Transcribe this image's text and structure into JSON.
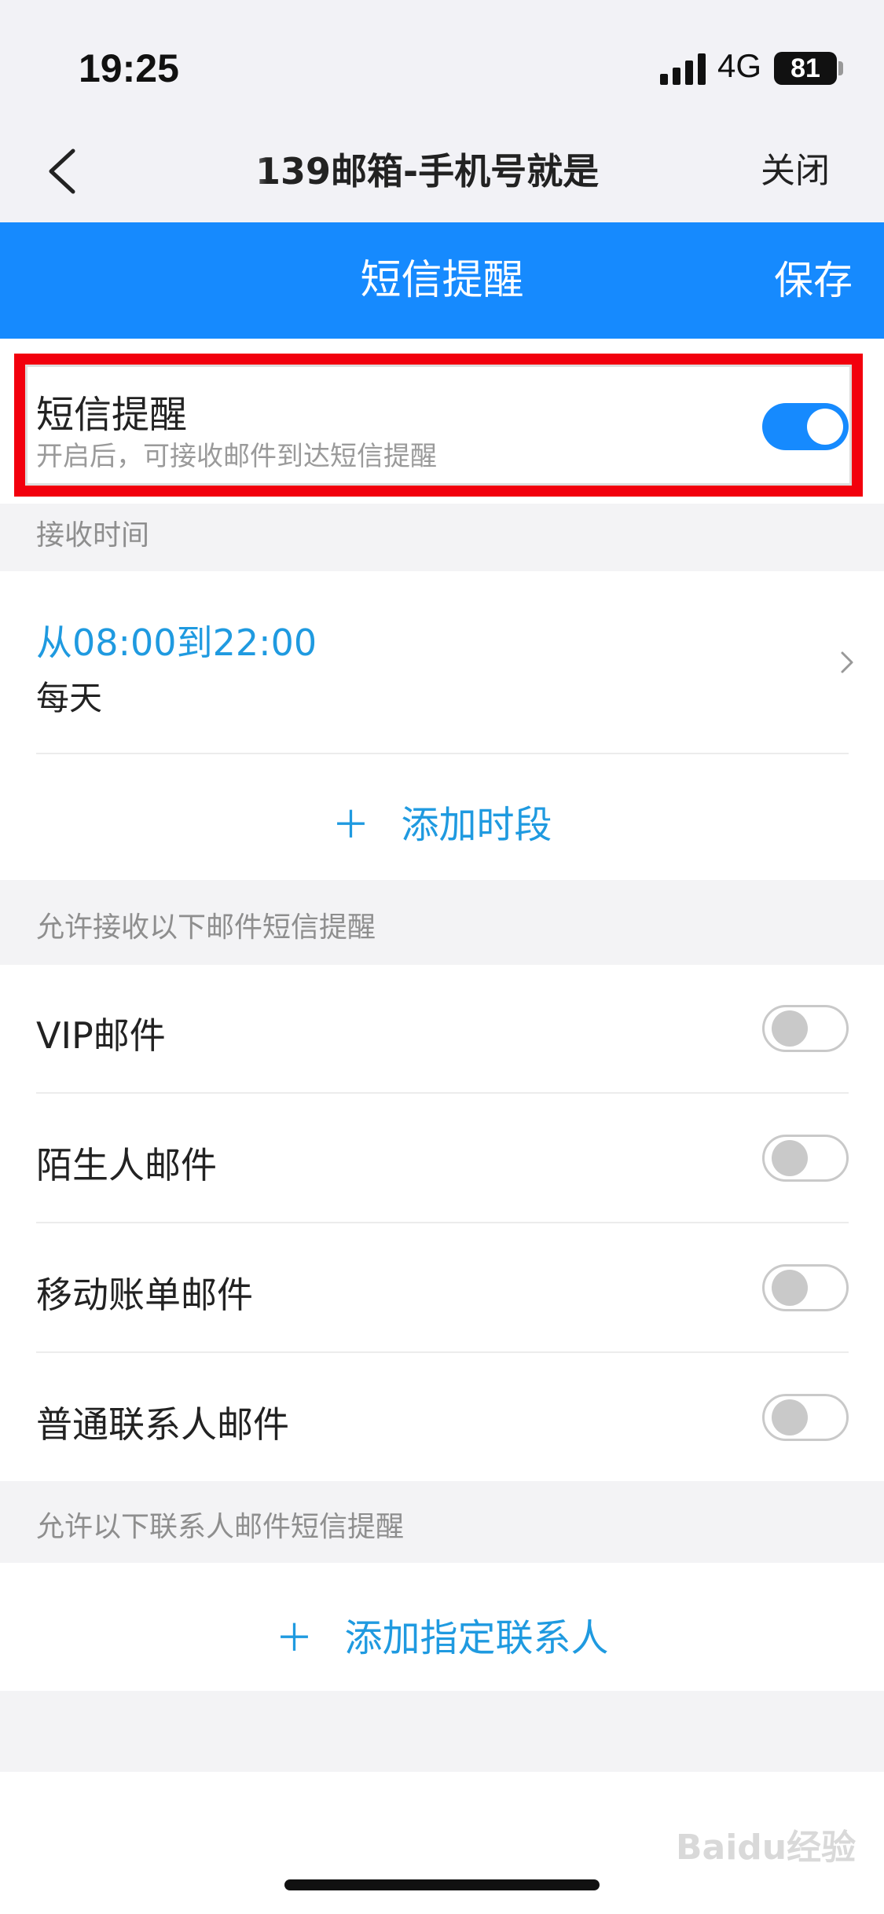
{
  "status_bar": {
    "time": "19:25",
    "network": "4G",
    "battery": "81"
  },
  "nav": {
    "title": "139邮箱-手机号就是",
    "close_label": "关闭"
  },
  "header": {
    "title": "短信提醒",
    "save_label": "保存"
  },
  "sms_toggle": {
    "title": "短信提醒",
    "subtitle": "开启后，可接收邮件到达短信提醒",
    "enabled": true
  },
  "receive_time": {
    "section_label": "接收时间",
    "range": "从08:00到22:00",
    "days": "每天",
    "add_period_label": "添加时段"
  },
  "mail_types": {
    "section_label": "允许接收以下邮件短信提醒",
    "items": [
      {
        "label": "VIP邮件",
        "enabled": false
      },
      {
        "label": "陌生人邮件",
        "enabled": false
      },
      {
        "label": "移动账单邮件",
        "enabled": false
      },
      {
        "label": "普通联系人邮件",
        "enabled": false
      }
    ]
  },
  "contacts": {
    "section_label": "允许以下联系人邮件短信提醒",
    "add_contact_label": "添加指定联系人"
  },
  "watermark": "Baidu经验",
  "colors": {
    "accent": "#168afe",
    "link": "#1f9ae0",
    "highlight": "#f2000d"
  }
}
